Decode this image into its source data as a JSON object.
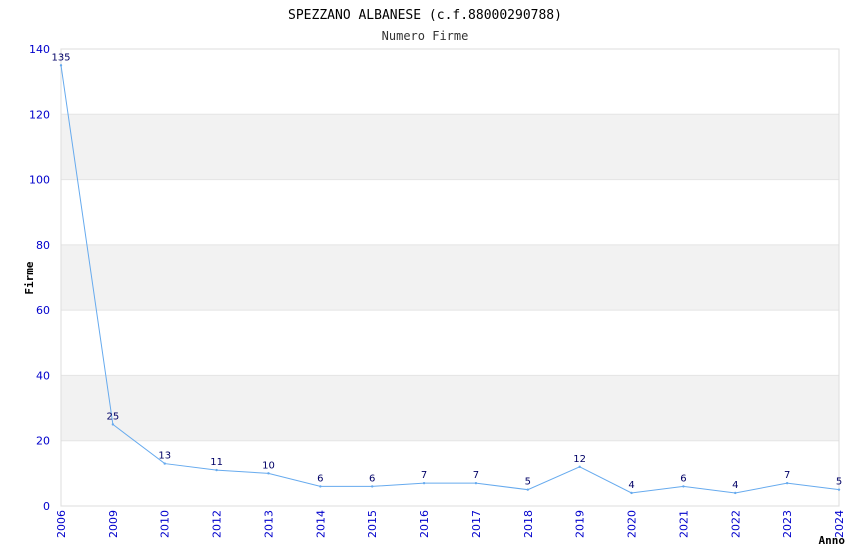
{
  "chart_data": {
    "type": "line",
    "title": "SPEZZANO ALBANESE (c.f.88000290788)",
    "subtitle": "Numero Firme",
    "xlabel": "Anno",
    "ylabel": "Firme",
    "x": [
      "2006",
      "2009",
      "2010",
      "2012",
      "2013",
      "2014",
      "2015",
      "2016",
      "2017",
      "2018",
      "2019",
      "2020",
      "2021",
      "2022",
      "2023",
      "2024"
    ],
    "values": [
      135,
      25,
      13,
      11,
      10,
      6,
      6,
      7,
      7,
      5,
      12,
      4,
      6,
      4,
      7,
      5
    ],
    "ylim": [
      0,
      140
    ],
    "yticks": [
      0,
      20,
      40,
      60,
      80,
      100,
      120,
      140
    ],
    "grid": true,
    "colors": {
      "line": "#66aaee",
      "band": "#f2f2f2",
      "tick_label": "#0000cc",
      "data_label": "#000066"
    }
  }
}
